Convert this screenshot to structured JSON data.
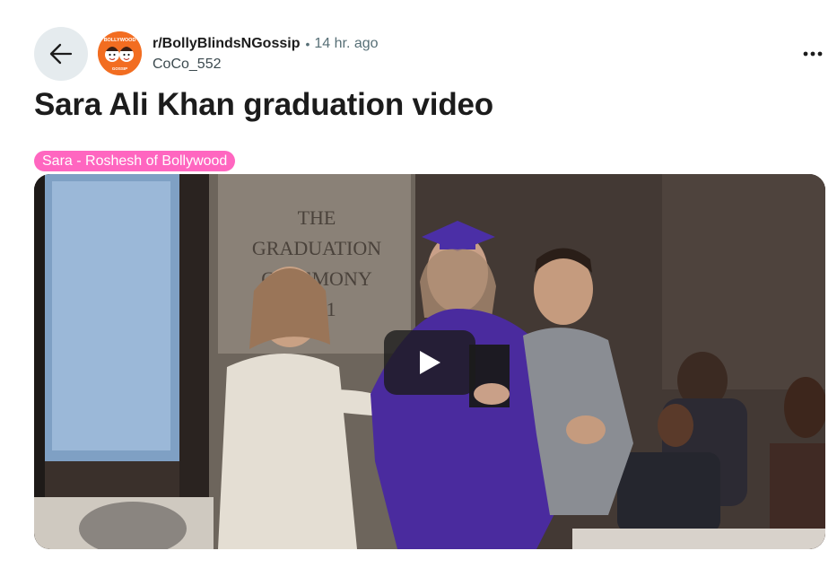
{
  "post": {
    "subreddit": "r/BollyBlindsNGossip",
    "separator": "•",
    "time_ago": "14 hr. ago",
    "author": "CoCo_552",
    "title": "Sara Ali Khan graduation video",
    "flair": "Sara - Roshesh of Bollywood"
  },
  "subreddit_avatar": {
    "logo_text_top": "BOLLYWOOD",
    "logo_text_bottom": "GOSSIP",
    "color": "#f26d21"
  },
  "video": {
    "backdrop_text": [
      "THE",
      "GRADUATION",
      "CEREMONY",
      "2011"
    ]
  },
  "icons": {
    "back": "arrow-left-icon",
    "more": "ellipsis-horizontal-icon",
    "play": "play-icon"
  },
  "colors": {
    "flair_background": "#ff66c0",
    "back_button_background": "#e5ebee",
    "gown_purple": "#4a2b9e"
  }
}
